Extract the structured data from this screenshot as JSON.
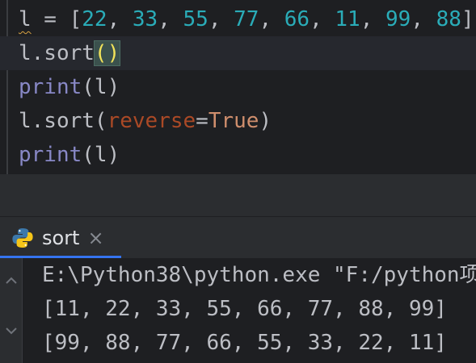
{
  "editor": {
    "lines": [
      {
        "tokens": [
          {
            "text": "l",
            "cls": "tok-var squiggle"
          },
          {
            "text": " = [",
            "cls": "tok-op"
          },
          {
            "text": "22",
            "cls": "tok-num"
          },
          {
            "text": ", ",
            "cls": "tok-punct"
          },
          {
            "text": "33",
            "cls": "tok-num"
          },
          {
            "text": ", ",
            "cls": "tok-punct"
          },
          {
            "text": "55",
            "cls": "tok-num"
          },
          {
            "text": ", ",
            "cls": "tok-punct"
          },
          {
            "text": "77",
            "cls": "tok-num"
          },
          {
            "text": ", ",
            "cls": "tok-punct"
          },
          {
            "text": "66",
            "cls": "tok-num"
          },
          {
            "text": ", ",
            "cls": "tok-punct"
          },
          {
            "text": "11",
            "cls": "tok-num"
          },
          {
            "text": ", ",
            "cls": "tok-punct"
          },
          {
            "text": "99",
            "cls": "tok-num"
          },
          {
            "text": ", ",
            "cls": "tok-punct"
          },
          {
            "text": "88",
            "cls": "tok-num"
          },
          {
            "text": "]",
            "cls": "tok-punct"
          }
        ]
      },
      {
        "current": true,
        "tokens": [
          {
            "text": "l.sort",
            "cls": "tok-var"
          },
          {
            "text": "()",
            "cls": "tok-paren-hl"
          }
        ]
      },
      {
        "tokens": [
          {
            "text": "print",
            "cls": "tok-builtin"
          },
          {
            "text": "(l)",
            "cls": "tok-punct"
          }
        ]
      },
      {
        "tokens": [
          {
            "text": "l.sort(",
            "cls": "tok-var"
          },
          {
            "text": "reverse",
            "cls": "tok-kwarg"
          },
          {
            "text": "=",
            "cls": "tok-op"
          },
          {
            "text": "True",
            "cls": "tok-kw"
          },
          {
            "text": ")",
            "cls": "tok-punct"
          }
        ]
      },
      {
        "tokens": [
          {
            "text": "print",
            "cls": "tok-builtin"
          },
          {
            "text": "(l)",
            "cls": "tok-punct"
          }
        ]
      }
    ]
  },
  "run_panel": {
    "tab_label": "sort",
    "tab_icon": "python-icon",
    "close_glyph": "×",
    "accent_color": "#3574f0"
  },
  "console": {
    "lines": [
      "E:\\Python38\\python.exe \"F:/python项",
      "[11, 22, 33, 55, 66, 77, 88, 99]",
      "[99, 88, 77, 66, 55, 33, 22, 11]"
    ]
  }
}
